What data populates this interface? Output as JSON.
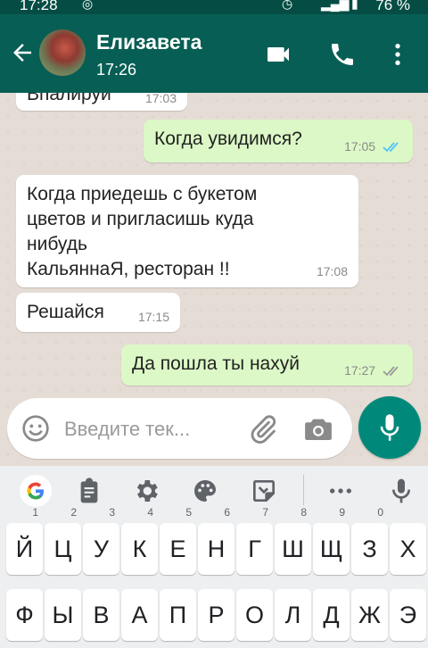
{
  "status_bar": {
    "time": "17:28",
    "battery": "76 %"
  },
  "header": {
    "contact_name": "Елизавета",
    "subtitle": "17:26"
  },
  "messages": [
    {
      "direction": "in",
      "text": "Впалируй",
      "time": "17:03"
    },
    {
      "direction": "out",
      "text": "Когда увидимся?",
      "time": "17:05",
      "status": "read"
    },
    {
      "direction": "in",
      "lines": [
        "Когда приедешь с букетом",
        "цветов и пригласишь куда",
        "нибудь",
        "КальяннаЯ, ресторан !!"
      ],
      "time": "17:08"
    },
    {
      "direction": "in",
      "text": "Решайся",
      "time": "17:15"
    },
    {
      "direction": "out",
      "text": "Да пошла ты нахуй",
      "time": "17:27",
      "status": "delivered"
    }
  ],
  "composer": {
    "placeholder": "Введите тек..."
  },
  "colors": {
    "header": "#075e54",
    "status_bar": "#054d44",
    "outgoing_bubble": "#dcf8c6",
    "incoming_bubble": "#ffffff",
    "mic_button": "#00897b",
    "read_ticks": "#4fc3f7"
  },
  "keyboard": {
    "toolbar_icons": [
      "google-icon",
      "clipboard-icon",
      "settings-icon",
      "palette-icon",
      "sticker-icon",
      "more-icon",
      "voice-input-icon"
    ],
    "row1": [
      {
        "key": "Й",
        "hint": "1"
      },
      {
        "key": "Ц",
        "hint": "2"
      },
      {
        "key": "У",
        "hint": "3"
      },
      {
        "key": "К",
        "hint": "4"
      },
      {
        "key": "Е",
        "hint": "5"
      },
      {
        "key": "Н",
        "hint": "6"
      },
      {
        "key": "Г",
        "hint": "7"
      },
      {
        "key": "Ш",
        "hint": "8"
      },
      {
        "key": "Щ",
        "hint": "9"
      },
      {
        "key": "З",
        "hint": "0"
      },
      {
        "key": "Х",
        "hint": ""
      }
    ],
    "row2": [
      "Ф",
      "Ы",
      "В",
      "А",
      "П",
      "Р",
      "О",
      "Л",
      "Д",
      "Ж",
      "Э"
    ]
  }
}
